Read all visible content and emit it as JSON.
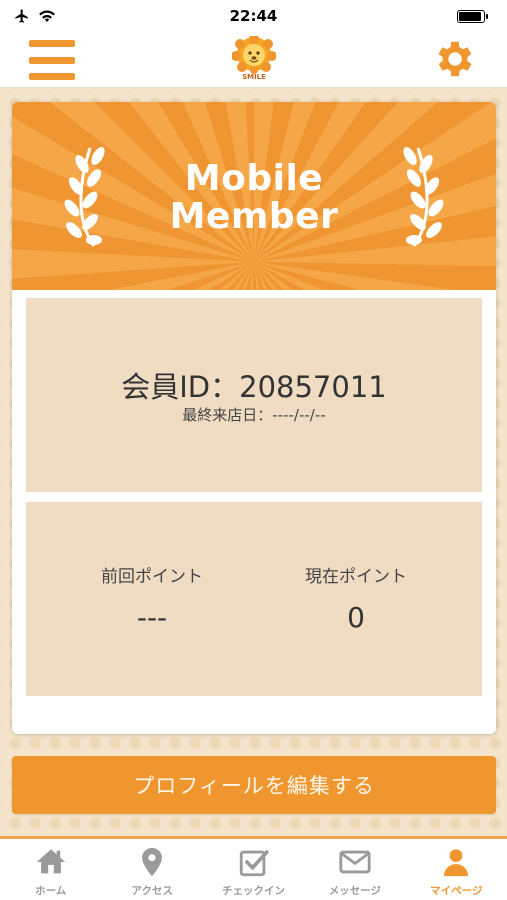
{
  "status_bar": {
    "time": "22:44"
  },
  "header": {
    "logo_text": "SMILE",
    "icons": {
      "menu": "hamburger-menu-icon",
      "settings": "gear-icon"
    }
  },
  "member_card": {
    "banner_title_line1": "Mobile",
    "banner_title_line2": "Member",
    "member_id_label": "会員ID：20857011",
    "last_visit_label": "最終来店日：----/--/--",
    "previous_points_label": "前回ポイント",
    "previous_points_value": "---",
    "current_points_label": "現在ポイント",
    "current_points_value": "0"
  },
  "edit_profile_button": "プロフィールを編集する",
  "tab_bar": {
    "tabs": [
      {
        "label": "ホーム",
        "icon": "home-icon"
      },
      {
        "label": "アクセス",
        "icon": "map-pin-icon"
      },
      {
        "label": "チェックイン",
        "icon": "checkbox-icon"
      },
      {
        "label": "メッセージ",
        "icon": "envelope-icon"
      },
      {
        "label": "マイページ",
        "icon": "user-icon",
        "active": true
      }
    ]
  },
  "colors": {
    "accent": "#f0962f",
    "panel": "#f0dcc3",
    "tab_inactive": "#9a9a9a"
  }
}
